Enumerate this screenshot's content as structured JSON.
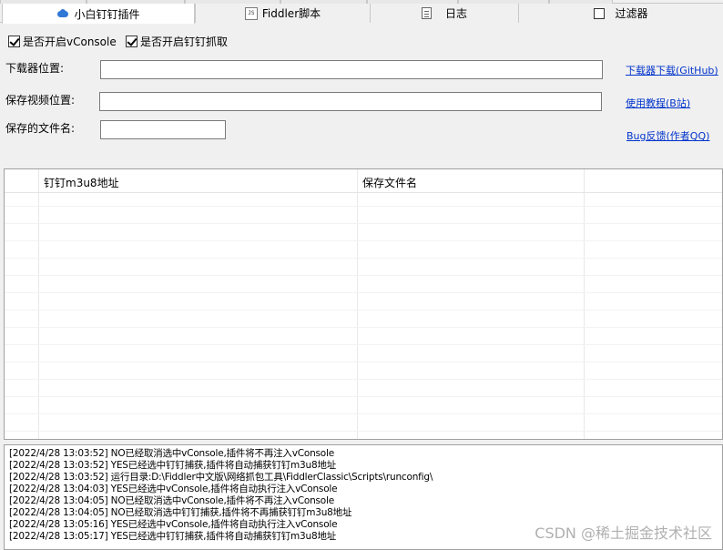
{
  "tabs": [
    {
      "label": "小白钉钉插件",
      "icon": "cloud-icon",
      "active": true
    },
    {
      "label": "Fiddler脚本",
      "icon": "js-file-icon",
      "active": false
    },
    {
      "label": "日志",
      "icon": "document-icon",
      "active": false
    },
    {
      "label": "过滤器",
      "icon": "checkbox-icon",
      "active": false
    }
  ],
  "options": {
    "vconsole_label": "是否开启vConsole",
    "dingtalk_label": "是否开启钉钉抓取"
  },
  "form": {
    "downloader_label": "下载器位置:",
    "downloader_value": "",
    "save_video_label": "保存视频位置:",
    "save_video_value": "",
    "filename_label": "保存的文件名:",
    "filename_value": ""
  },
  "links": {
    "download": "下载器下载(GitHub)",
    "tutorial": "使用教程(B站)",
    "feedback": "Bug反馈(作者QQ)"
  },
  "table": {
    "columns": [
      "钉钉m3u8地址",
      "保存文件名"
    ]
  },
  "log": [
    "[2022/4/28 13:03:52] NO已经取消选中vConsole,插件将不再注入vConsole",
    "[2022/4/28 13:03:52] YES已经选中钉钉捕获,插件将自动捕获钉钉m3u8地址",
    "[2022/4/28 13:03:52] 运行目录:D:\\Fiddler中文版\\网络抓包工具\\FiddlerClassic\\Scripts\\runconfig\\",
    "[2022/4/28 13:04:03] YES已经选中vConsole,插件将自动执行注入vConsole",
    "[2022/4/28 13:04:05] NO已经取消选中vConsole,插件将不再注入vConsole",
    "[2022/4/28 13:04:05] NO已经取消选中钉钉捕获,插件将不再捕获钉钉m3u8地址",
    "[2022/4/28 13:05:16] YES已经选中vConsole,插件将自动执行注入vConsole",
    "[2022/4/28 13:05:17] YES已经选中钉钉捕获,插件将自动捕获钉钉m3u8地址"
  ],
  "watermark": "CSDN @稀土掘金技术社区",
  "colors": {
    "link": "#0033cc",
    "accent": "#2f78d6"
  }
}
